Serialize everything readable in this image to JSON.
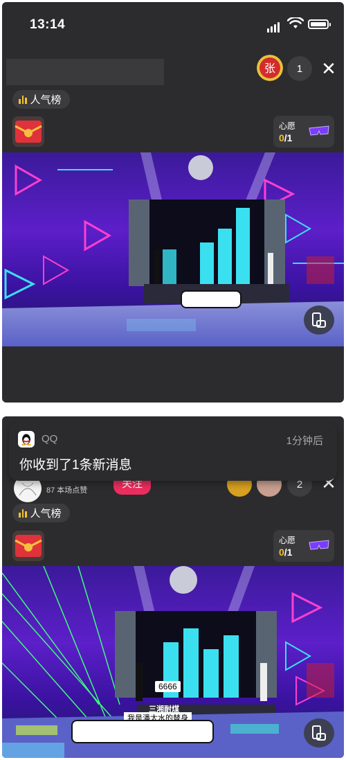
{
  "status_bar": {
    "time": "13:14"
  },
  "top_panel": {
    "viewer_count": "1",
    "rank_label": "人气榜",
    "wish": {
      "title": "心愿",
      "current": "0",
      "total": "/1"
    }
  },
  "notification": {
    "app": "QQ",
    "time": "1分钟后",
    "message": "你收到了1条新消息"
  },
  "bottom_panel": {
    "likes": "87 本场点赞",
    "follow_label": "关注",
    "viewer_count": "2",
    "rank_label": "人气榜",
    "wish": {
      "title": "心愿",
      "current": "0",
      "total": "/1"
    },
    "stage_score": "6666",
    "stage_line1": "三湘耐煤",
    "stage_line2": "我是潘太水的替身"
  },
  "colors": {
    "panel_bg": "#2c2c2e",
    "accent_yellow": "#f2c230",
    "follow_pink": "#ee2d5f",
    "neon_cyan": "#3be0f0",
    "neon_pink": "#ff3fd0"
  },
  "icons": [
    "signal-icon",
    "wifi-icon",
    "battery-icon",
    "close-icon",
    "chart-bars-icon",
    "gift-envelope-icon",
    "glasses-icon",
    "rotate-screen-icon",
    "qq-penguin-icon"
  ]
}
